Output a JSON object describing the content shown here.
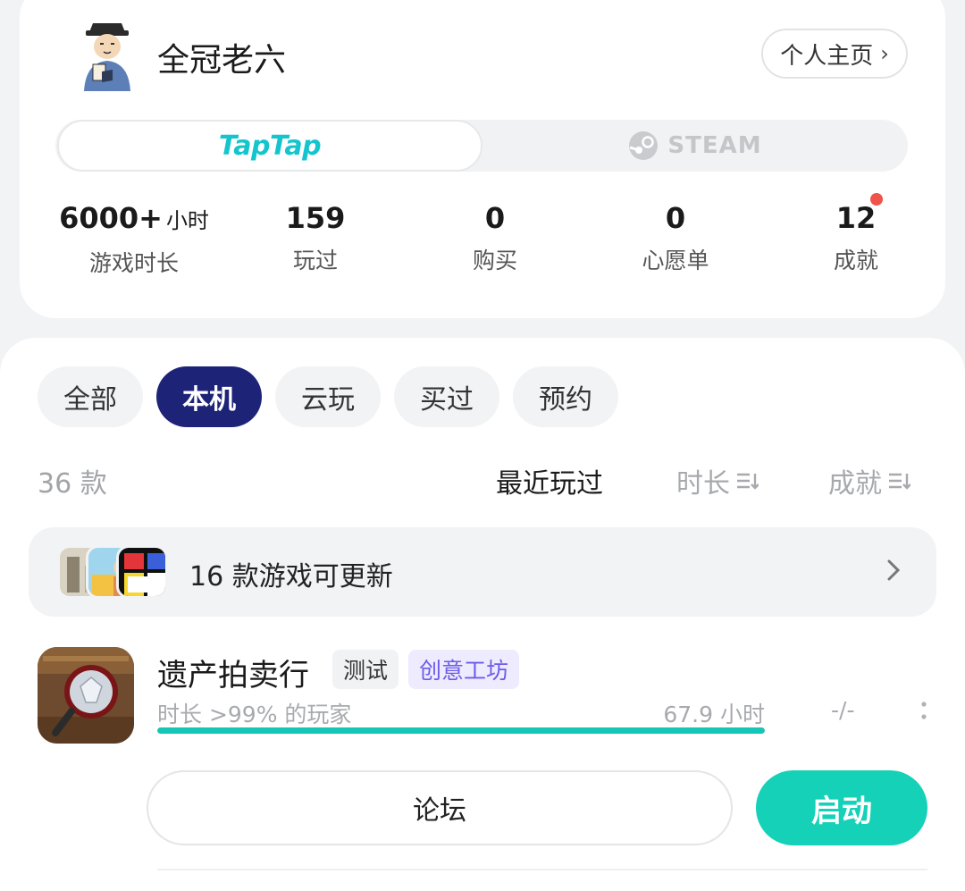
{
  "profile": {
    "username": "全冠老六",
    "homepage_label": "个人主页"
  },
  "platforms": {
    "taptap": "TapTap",
    "steam": "STEAM",
    "selected": "TapTap"
  },
  "stats": [
    {
      "value": "6000+",
      "unit": "小时",
      "label": "游戏时长"
    },
    {
      "value": "159",
      "label": "玩过"
    },
    {
      "value": "0",
      "label": "购买"
    },
    {
      "value": "0",
      "label": "心愿单"
    },
    {
      "value": "12",
      "label": "成就",
      "badge": true
    }
  ],
  "filters": [
    "全部",
    "本机",
    "云玩",
    "买过",
    "预约"
  ],
  "active_filter": "本机",
  "list": {
    "count": "36 款",
    "sorts": [
      "最近玩过",
      "时长",
      "成就"
    ],
    "active_sort": "最近玩过"
  },
  "update_banner": {
    "text": "16 款游戏可更新"
  },
  "game": {
    "title": "遗产拍卖行",
    "tags": [
      "测试",
      "创意工坊"
    ],
    "playtime_label": "时长 >99% 的玩家",
    "hours": "67.9 小时",
    "achievements": "-/-",
    "progress_fraction": 1.0,
    "forum_label": "论坛",
    "launch_label": "启动"
  },
  "colors": {
    "brand": "#15c5ce",
    "active_chip": "#1d2377",
    "launch": "#15d1b8",
    "workshop_tag": "#6b5ce6"
  }
}
